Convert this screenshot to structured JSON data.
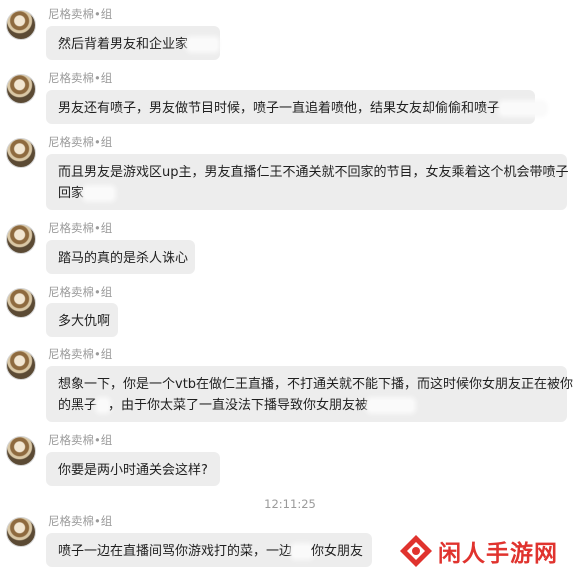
{
  "chat": {
    "messages": [
      {
        "sender": "尼格卖棉•组",
        "lines": [
          "然后背着男友和企业家"
        ]
      },
      {
        "sender": "尼格卖棉•组",
        "lines": [
          "男友还有喷子，男友做节目时候，喷子一直追着喷他，结果女友却偷偷和喷子"
        ]
      },
      {
        "sender": "尼格卖棉•组",
        "lines": [
          "而且男友是游戏区up主，男友直播仁王不通关就不回家的节目，女友乘着这个机会带喷子",
          "回家"
        ]
      },
      {
        "sender": "尼格卖棉•组",
        "lines": [
          "踏马的真的是杀人诛心"
        ]
      },
      {
        "sender": "尼格卖棉•组",
        "lines": [
          "多大仇啊"
        ]
      },
      {
        "sender": "尼格卖棉•组",
        "lines": [
          "想象一下，你是一个vtb在做仁王直播，不打通关就不能下播，而这时候你女朋友正在被你",
          "的黑子",
          "，由于你太菜了一直没法下播导致你女朋友被"
        ]
      },
      {
        "sender": "尼格卖棉•组",
        "lines": [
          "你要是两小时通关会这样?"
        ]
      },
      {
        "sender": "尼格卖棉•组",
        "lines": [
          "喷子一边在直播间骂你游戏打的菜，一边",
          "你女朋友"
        ]
      }
    ],
    "timestamp": "12:11:25"
  },
  "watermark": {
    "text": "闲人手游网",
    "color": "#e0332e"
  }
}
